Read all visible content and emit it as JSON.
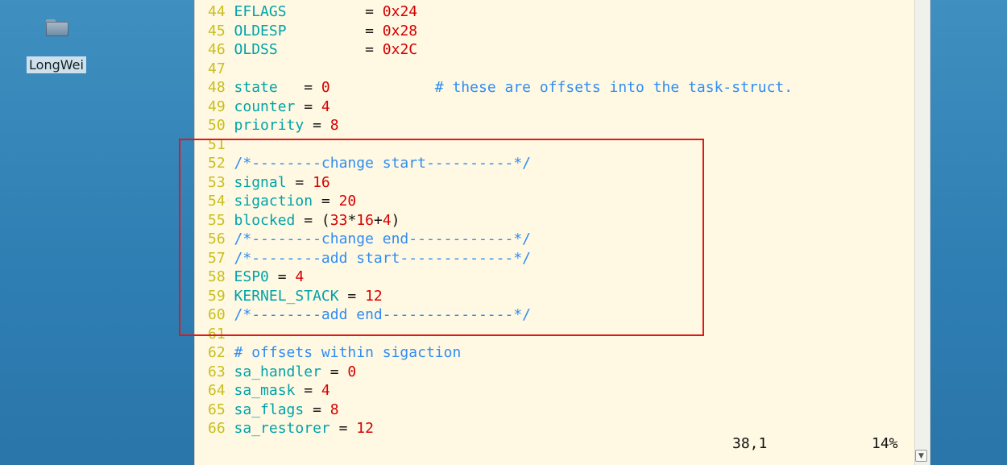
{
  "desktop": {
    "icon_label": "LongWei",
    "icon_name": "folder-icon"
  },
  "editor": {
    "lines": [
      {
        "ln": "44",
        "tokens": [
          {
            "t": "var",
            "v": "EFLAGS"
          },
          {
            "t": "op",
            "v": "         = "
          },
          {
            "t": "num",
            "v": "0x24"
          }
        ]
      },
      {
        "ln": "45",
        "tokens": [
          {
            "t": "var",
            "v": "OLDESP"
          },
          {
            "t": "op",
            "v": "         = "
          },
          {
            "t": "num",
            "v": "0x28"
          }
        ]
      },
      {
        "ln": "46",
        "tokens": [
          {
            "t": "var",
            "v": "OLDSS"
          },
          {
            "t": "op",
            "v": "          = "
          },
          {
            "t": "num",
            "v": "0x2C"
          }
        ]
      },
      {
        "ln": "47",
        "tokens": []
      },
      {
        "ln": "48",
        "tokens": [
          {
            "t": "var",
            "v": "state"
          },
          {
            "t": "op",
            "v": "   = "
          },
          {
            "t": "num",
            "v": "0"
          },
          {
            "t": "op",
            "v": "            "
          },
          {
            "t": "comment",
            "v": "# these are offsets into the task-struct."
          }
        ]
      },
      {
        "ln": "49",
        "tokens": [
          {
            "t": "var",
            "v": "counter"
          },
          {
            "t": "op",
            "v": " = "
          },
          {
            "t": "num",
            "v": "4"
          }
        ]
      },
      {
        "ln": "50",
        "tokens": [
          {
            "t": "var",
            "v": "priority"
          },
          {
            "t": "op",
            "v": " = "
          },
          {
            "t": "num",
            "v": "8"
          }
        ]
      },
      {
        "ln": "51",
        "tokens": []
      },
      {
        "ln": "52",
        "tokens": [
          {
            "t": "comment",
            "v": "/*--------change start----------*/"
          }
        ]
      },
      {
        "ln": "53",
        "tokens": [
          {
            "t": "var",
            "v": "signal"
          },
          {
            "t": "op",
            "v": " = "
          },
          {
            "t": "num",
            "v": "16"
          }
        ]
      },
      {
        "ln": "54",
        "tokens": [
          {
            "t": "var",
            "v": "sigaction"
          },
          {
            "t": "op",
            "v": " = "
          },
          {
            "t": "num",
            "v": "20"
          }
        ]
      },
      {
        "ln": "55",
        "tokens": [
          {
            "t": "var",
            "v": "blocked"
          },
          {
            "t": "op",
            "v": " = ("
          },
          {
            "t": "num",
            "v": "33"
          },
          {
            "t": "op",
            "v": "*"
          },
          {
            "t": "num",
            "v": "16"
          },
          {
            "t": "op",
            "v": "+"
          },
          {
            "t": "num",
            "v": "4"
          },
          {
            "t": "op",
            "v": ")"
          }
        ]
      },
      {
        "ln": "56",
        "tokens": [
          {
            "t": "comment",
            "v": "/*--------change end------------*/"
          }
        ]
      },
      {
        "ln": "57",
        "tokens": [
          {
            "t": "comment",
            "v": "/*--------add start-------------*/"
          }
        ]
      },
      {
        "ln": "58",
        "tokens": [
          {
            "t": "var",
            "v": "ESP0"
          },
          {
            "t": "op",
            "v": " = "
          },
          {
            "t": "num",
            "v": "4"
          }
        ]
      },
      {
        "ln": "59",
        "tokens": [
          {
            "t": "var",
            "v": "KERNEL_STACK"
          },
          {
            "t": "op",
            "v": " = "
          },
          {
            "t": "num",
            "v": "12"
          }
        ]
      },
      {
        "ln": "60",
        "tokens": [
          {
            "t": "comment",
            "v": "/*--------add end---------------*/"
          }
        ]
      },
      {
        "ln": "61",
        "tokens": []
      },
      {
        "ln": "62",
        "tokens": [
          {
            "t": "comment",
            "v": "# offsets within sigaction"
          }
        ]
      },
      {
        "ln": "63",
        "tokens": [
          {
            "t": "var",
            "v": "sa_handler"
          },
          {
            "t": "op",
            "v": " = "
          },
          {
            "t": "num",
            "v": "0"
          }
        ]
      },
      {
        "ln": "64",
        "tokens": [
          {
            "t": "var",
            "v": "sa_mask"
          },
          {
            "t": "op",
            "v": " = "
          },
          {
            "t": "num",
            "v": "4"
          }
        ]
      },
      {
        "ln": "65",
        "tokens": [
          {
            "t": "var",
            "v": "sa_flags"
          },
          {
            "t": "op",
            "v": " = "
          },
          {
            "t": "num",
            "v": "8"
          }
        ]
      },
      {
        "ln": "66",
        "tokens": [
          {
            "t": "var",
            "v": "sa_restorer"
          },
          {
            "t": "op",
            "v": " = "
          },
          {
            "t": "num",
            "v": "12"
          }
        ]
      }
    ],
    "status": {
      "position": "38,1",
      "percent": "14%"
    },
    "colors": {
      "background": "#fff8e3",
      "line_number": "#c7bf1d",
      "identifier": "#00a3a8",
      "number": "#d50000",
      "comment": "#2f8df2",
      "highlight_box": "#e01818"
    }
  }
}
